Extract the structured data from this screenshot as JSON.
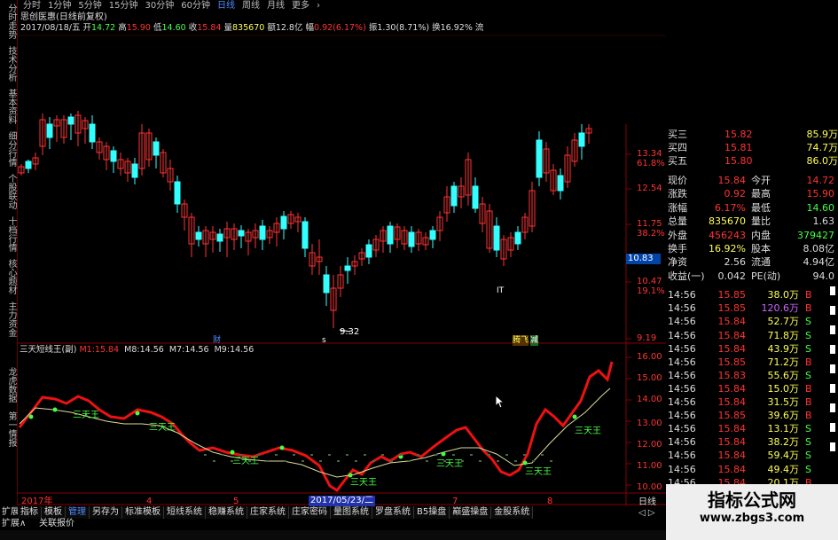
{
  "top_tabs": [
    "分时",
    "1分钟",
    "5分钟",
    "15分钟",
    "30分钟",
    "60分钟",
    "日线",
    "周线",
    "月线",
    "更多",
    "›"
  ],
  "top_tab_active": 6,
  "side_tabs": [
    "分时走势",
    "技术分析",
    "基本资料",
    "细分行情",
    "个股联动",
    "十档行情",
    "核心题材",
    "主力资金",
    "龙虎数据",
    "第一情报"
  ],
  "header": {
    "stock_title": "思创医惠(日线前复权)",
    "date": "2017/08/18/五",
    "open_label": "开",
    "open": "14.72",
    "high_label": "高",
    "high": "15.90",
    "low_label": "低",
    "low": "14.60",
    "close_label": "收",
    "close": "15.84",
    "volume_label": "量",
    "volume": "835670",
    "amount_label": "额",
    "amount": "12.8亿",
    "change_label": "幅",
    "change": "0.92(6.17%)",
    "amplitude_label": "振",
    "amplitude": "1.30(8.71%)",
    "turnover_label": "换",
    "turnover": "16.92%",
    "flow_label": "流"
  },
  "price_axis": [
    "13.34",
    "61.8%",
    "12.54",
    "11.75",
    "38.2%",
    "10.83",
    "10.47",
    "19.1%",
    "9.19"
  ],
  "price_axis_current": "10.83",
  "low_marker": "9.32",
  "chart_markers": {
    "m1": "财",
    "m2": "s",
    "m3": "IT",
    "m4": "腾飞",
    "m5": "减"
  },
  "indicator": {
    "name": "三天短线王(副)",
    "m1_label": "M1:",
    "m1_value": "15.84",
    "m8_label": "M8:",
    "m8_value": "14.56",
    "m7_label": "M7:",
    "m7_value": "14.56",
    "m9_label": "M9:",
    "m9_value": "14.56",
    "axis": [
      "16.00",
      "15.00",
      "14.00",
      "13.00",
      "12.00",
      "11.00",
      "10.00"
    ],
    "king_label": "三天王"
  },
  "date_axis": {
    "year": "2017年",
    "t4": "4",
    "t5": "5",
    "cursor_date": "2017/05/23/二",
    "t7": "7",
    "t8": "8"
  },
  "order_book": {
    "asks": [
      {
        "label": "买三",
        "price": "15.82",
        "vol": "85.9万"
      },
      {
        "label": "买四",
        "price": "15.81",
        "vol": "74.7万"
      },
      {
        "label": "买五",
        "price": "15.80",
        "vol": "86.0万"
      }
    ],
    "stats": [
      {
        "l1": "现价",
        "v1": "15.84",
        "l2": "今开",
        "v2": "14.72"
      },
      {
        "l1": "涨跌",
        "v1": "0.92",
        "l2": "最高",
        "v2": "15.90"
      },
      {
        "l1": "涨幅",
        "v1": "6.17%",
        "l2": "最低",
        "v2": "14.60"
      },
      {
        "l1": "总量",
        "v1": "835670",
        "l2": "量比",
        "v2": "1.63"
      },
      {
        "l1": "外盘",
        "v1": "456243",
        "l2": "内盘",
        "v2": "379427"
      },
      {
        "l1": "换手",
        "v1": "16.92%",
        "l2": "股本",
        "v2": "8.08亿"
      },
      {
        "l1": "净资",
        "v1": "2.56",
        "l2": "流通",
        "v2": "4.94亿"
      },
      {
        "l1": "收益(一)",
        "v1": "0.042",
        "l2": "PE(动)",
        "v2": "94.0"
      }
    ]
  },
  "ticks": [
    {
      "time": "14:56",
      "price": "15.85",
      "vol": "38.0万",
      "side": "B"
    },
    {
      "time": "14:56",
      "price": "15.85",
      "vol": "120.6万",
      "side": "B"
    },
    {
      "time": "14:56",
      "price": "15.84",
      "vol": "52.7万",
      "side": "S"
    },
    {
      "time": "14:56",
      "price": "15.84",
      "vol": "71.8万",
      "side": "S"
    },
    {
      "time": "14:56",
      "price": "15.84",
      "vol": "43.9万",
      "side": "S"
    },
    {
      "time": "14:56",
      "price": "15.85",
      "vol": "71.2万",
      "side": "B"
    },
    {
      "time": "14:56",
      "price": "15.83",
      "vol": "55.6万",
      "side": "S"
    },
    {
      "time": "14:56",
      "price": "15.84",
      "vol": "15.0万",
      "side": "B"
    },
    {
      "time": "14:56",
      "price": "15.84",
      "vol": "31.5万",
      "side": "B"
    },
    {
      "time": "14:56",
      "price": "15.85",
      "vol": "39.6万",
      "side": "B"
    },
    {
      "time": "14:56",
      "price": "15.84",
      "vol": "13.1万",
      "side": "S"
    },
    {
      "time": "14:56",
      "price": "15.84",
      "vol": "38.2万",
      "side": "S"
    },
    {
      "time": "14:56",
      "price": "15.84",
      "vol": "59.4万",
      "side": "S"
    },
    {
      "time": "14:56",
      "price": "15.84",
      "vol": "49.4万",
      "side": "S"
    },
    {
      "time": "14:56",
      "price": "15.84",
      "vol": "20.1万",
      "side": "B"
    }
  ],
  "right_bottom": {
    "daily": "日线",
    "arrow": "◁ ▷"
  },
  "bottom_tabs": [
    "指标",
    "模板",
    "管理",
    "另存为",
    "标准模板",
    "短线系统",
    "稳赚系统",
    "庄家系统",
    "庄家密码",
    "量图系统",
    "罗盘系统",
    "B5操盘",
    "巅盛操盘",
    "金股系统"
  ],
  "bottom_tab_active": 2,
  "bottom_left": {
    "extend": "扩展∧",
    "quote": "关联报价"
  },
  "watermark": {
    "line1": "指标公式网",
    "line2": "www.zbgs3.com"
  },
  "colors": {
    "up": "#ff3333",
    "down": "#33ffff",
    "yellow": "#ffff55",
    "green": "#44ff44",
    "purple": "#cc44cc",
    "blue": "#4d8bff"
  }
}
